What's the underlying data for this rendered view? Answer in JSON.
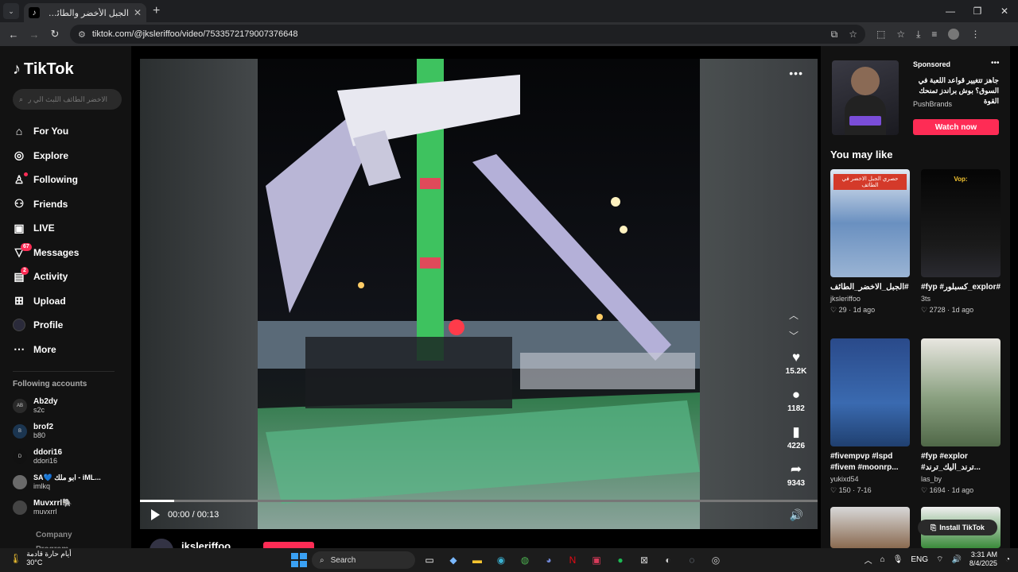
{
  "browser": {
    "tab_title": "الجبل الأخضر والطائف: تجربة مثيرة",
    "url": "tiktok.com/@jksleriffoo/video/7533572179007376648"
  },
  "sidebar": {
    "brand": "TikTok",
    "search_placeholder": "الاخضر الطائف اللبث الي رجلها",
    "nav": [
      {
        "label": "For You",
        "icon": "home-icon"
      },
      {
        "label": "Explore",
        "icon": "compass-icon"
      },
      {
        "label": "Following",
        "icon": "following-icon"
      },
      {
        "label": "Friends",
        "icon": "friends-icon"
      },
      {
        "label": "LIVE",
        "icon": "live-icon"
      },
      {
        "label": "Messages",
        "icon": "messages-icon",
        "badge": "67"
      },
      {
        "label": "Activity",
        "icon": "activity-icon",
        "badge": "2"
      },
      {
        "label": "Upload",
        "icon": "upload-icon"
      },
      {
        "label": "Profile",
        "icon": "profile-icon"
      },
      {
        "label": "More",
        "icon": "more-icon"
      }
    ],
    "following_title": "Following accounts",
    "accounts": [
      {
        "name": "Ab2dy",
        "handle": "s2c",
        "avatar": "AB"
      },
      {
        "name": "brof2",
        "handle": "b80",
        "avatar": "B"
      },
      {
        "name": "ddori16",
        "handle": "ddori16",
        "avatar": "D"
      },
      {
        "name": "SA💙 ابو ملك - iML...",
        "handle": "imlkq",
        "avatar": ""
      },
      {
        "name": "Muvxrrl🐘",
        "handle": "muvxrrl",
        "avatar": ""
      }
    ],
    "footer": [
      "Company",
      "Program"
    ]
  },
  "video": {
    "time": "00:00 / 00:13",
    "progress": 0.05,
    "likes": "15.2K",
    "comments": "1182",
    "saves": "4226",
    "shares": "9343",
    "author": "jksleriffoo"
  },
  "ad": {
    "sponsored": "Sponsored",
    "text": "جاهز تتغيير قواعد اللعبة في السوق؟ بوش براندز تمنحك القوة",
    "brand": "PushBrands",
    "cta": "Watch now"
  },
  "recommendations": {
    "title": "You may like",
    "items": [
      {
        "caption": "#الجبل_الاخضر_الطائف",
        "user": "jksleriffoo",
        "likes": "29",
        "date": "1d ago",
        "overlay": "حصري الجبل الاخضر في الطائف"
      },
      {
        "caption": "#fyp #كسبلور_explor#ffff...",
        "user": "3ts",
        "likes": "2728",
        "date": "1d ago",
        "overlay": "Vop:"
      },
      {
        "caption": "#fivempvp #lspd #fivem #moonrp...",
        "user": "yukixd54",
        "likes": "150",
        "date": "7-16",
        "overlay": ""
      },
      {
        "caption": "#fyp #explor #ترند_اليك_ترند...",
        "user": "las_by",
        "likes": "1694",
        "date": "1d ago",
        "overlay": ""
      }
    ],
    "install": "Install TikTok"
  },
  "taskbar": {
    "weather_text": "أيام حارة قادمة",
    "temp": "30°C",
    "search": "Search",
    "lang": "ENG",
    "time": "3:31 AM",
    "date": "8/4/2025"
  }
}
